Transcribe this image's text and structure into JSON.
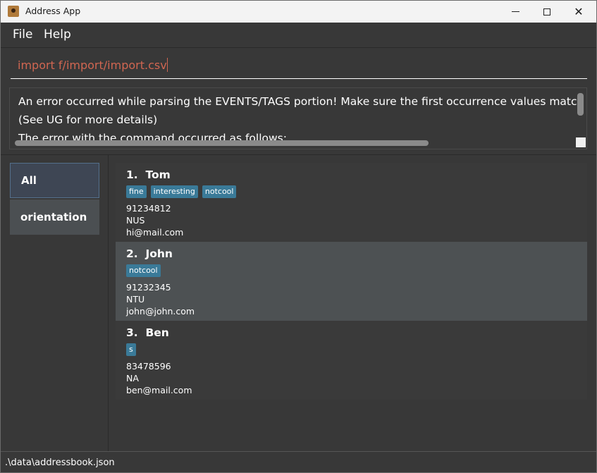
{
  "window": {
    "title": "Address App"
  },
  "menu": {
    "file": "File",
    "help": "Help"
  },
  "command": {
    "value": "import f/import/import.csv"
  },
  "result": {
    "lines": [
      "An error occurred while parsing the EVENTS/TAGS portion! Make sure the first occurrence values match the c",
      "(See UG for more details)",
      "The error with the command occurred as follows:"
    ]
  },
  "sidebar": {
    "items": [
      {
        "label": "All",
        "selected": true
      },
      {
        "label": "orientation",
        "selected": false
      }
    ]
  },
  "persons": [
    {
      "index": "1.",
      "name": "Tom",
      "tags": [
        "fine",
        "interesting",
        "notcool"
      ],
      "phone": "91234812",
      "address": "NUS",
      "email": "hi@mail.com"
    },
    {
      "index": "2.",
      "name": "John",
      "tags": [
        "notcool"
      ],
      "phone": "91232345",
      "address": "NTU",
      "email": "john@john.com"
    },
    {
      "index": "3.",
      "name": "Ben",
      "tags": [
        "s"
      ],
      "phone": "83478596",
      "address": "NA",
      "email": "ben@mail.com"
    }
  ],
  "status": {
    "path": ".\\data\\addressbook.json"
  },
  "colors": {
    "accent": "#3a7a98",
    "error_text": "#d06651",
    "background": "#383838",
    "selected_card": "#4d5153"
  }
}
